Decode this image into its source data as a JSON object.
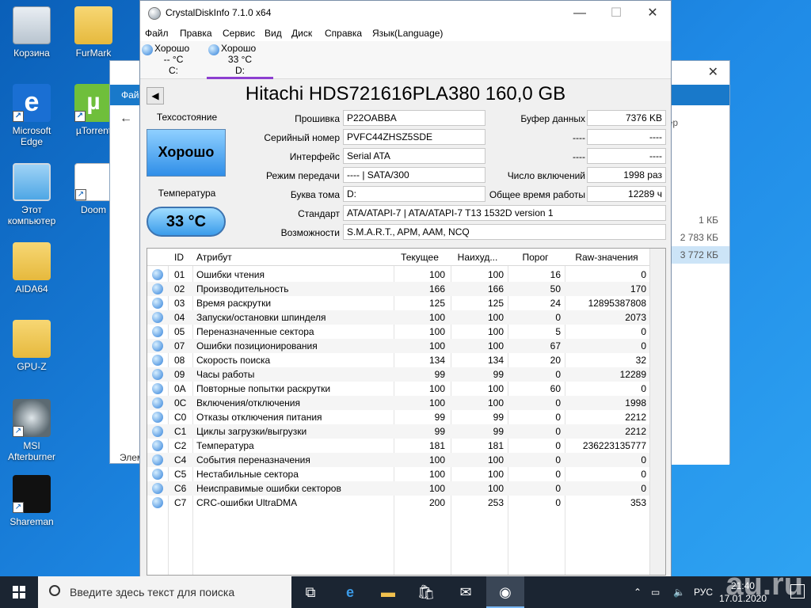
{
  "desktop": {
    "icons": [
      "Корзина",
      "FurMark",
      "Microsoft Edge",
      "µTorrent",
      "Этот компьютер",
      "Doom",
      "AIDA64",
      "GPU-Z",
      "MSI Afterburner",
      "Shareman"
    ]
  },
  "explorer": {
    "ribbon_tab": "Фай",
    "size_col": "змер",
    "sizes": [
      "1 КБ",
      "2 783 КБ",
      "3 772 КБ"
    ],
    "status": "Элем"
  },
  "window": {
    "title": "CrystalDiskInfo 7.1.0 x64",
    "menu": [
      "Файл",
      "Правка",
      "Сервис",
      "Вид",
      "Диск",
      "Справка",
      "Язык(Language)"
    ]
  },
  "drives": [
    {
      "status": "Хорошо",
      "temp": "-- °C",
      "letter": "C:"
    },
    {
      "status": "Хорошо",
      "temp": "33 °C",
      "letter": "D:"
    }
  ],
  "disk": {
    "model": "Hitachi HDS721616PLA380 160,0 GB",
    "health_label": "Техсостояние",
    "health": "Хорошо",
    "temp_label": "Температура",
    "temp": "33 °C",
    "firmware_label": "Прошивка",
    "firmware": "P22OABBA",
    "serial_label": "Серийный номер",
    "serial": "PVFC44ZHSZ5SDE",
    "interface_label": "Интерфейс",
    "interface": "Serial ATA",
    "transfer_label": "Режим передачи",
    "transfer": "---- | SATA/300",
    "letter_label": "Буква тома",
    "letter": "D:",
    "standard_label": "Стандарт",
    "standard": "ATA/ATAPI-7 | ATA/ATAPI-7 T13 1532D version 1",
    "features_label": "Возможности",
    "features": "S.M.A.R.T., APM, AAM, NCQ",
    "buffer_label": "Буфер данных",
    "buffer": "7376 KB",
    "blank1_label": "----",
    "blank1": "----",
    "blank2_label": "----",
    "blank2": "----",
    "power_count_label": "Число включений",
    "power_count": "1998 раз",
    "power_hours_label": "Общее время работы",
    "power_hours": "12289 ч"
  },
  "smart": {
    "headers": {
      "id": "ID",
      "name": "Атрибут",
      "cur": "Текущее",
      "worst": "Наихуд...",
      "thr": "Порог",
      "raw": "Raw-значения"
    },
    "rows": [
      {
        "id": "01",
        "name": "Ошибки чтения",
        "cur": "100",
        "worst": "100",
        "thr": "16",
        "raw": "0"
      },
      {
        "id": "02",
        "name": "Производительность",
        "cur": "166",
        "worst": "166",
        "thr": "50",
        "raw": "170"
      },
      {
        "id": "03",
        "name": "Время раскрутки",
        "cur": "125",
        "worst": "125",
        "thr": "24",
        "raw": "12895387808"
      },
      {
        "id": "04",
        "name": "Запуски/остановки шпинделя",
        "cur": "100",
        "worst": "100",
        "thr": "0",
        "raw": "2073"
      },
      {
        "id": "05",
        "name": "Переназначенные сектора",
        "cur": "100",
        "worst": "100",
        "thr": "5",
        "raw": "0"
      },
      {
        "id": "07",
        "name": "Ошибки позиционирования",
        "cur": "100",
        "worst": "100",
        "thr": "67",
        "raw": "0"
      },
      {
        "id": "08",
        "name": "Скорость поиска",
        "cur": "134",
        "worst": "134",
        "thr": "20",
        "raw": "32"
      },
      {
        "id": "09",
        "name": "Часы работы",
        "cur": "99",
        "worst": "99",
        "thr": "0",
        "raw": "12289"
      },
      {
        "id": "0A",
        "name": "Повторные попытки раскрутки",
        "cur": "100",
        "worst": "100",
        "thr": "60",
        "raw": "0"
      },
      {
        "id": "0C",
        "name": "Включения/отключения",
        "cur": "100",
        "worst": "100",
        "thr": "0",
        "raw": "1998"
      },
      {
        "id": "C0",
        "name": "Отказы отключения питания",
        "cur": "99",
        "worst": "99",
        "thr": "0",
        "raw": "2212"
      },
      {
        "id": "C1",
        "name": "Циклы загрузки/выгрузки",
        "cur": "99",
        "worst": "99",
        "thr": "0",
        "raw": "2212"
      },
      {
        "id": "C2",
        "name": "Температура",
        "cur": "181",
        "worst": "181",
        "thr": "0",
        "raw": "236223135777"
      },
      {
        "id": "C4",
        "name": "События переназначения",
        "cur": "100",
        "worst": "100",
        "thr": "0",
        "raw": "0"
      },
      {
        "id": "C5",
        "name": "Нестабильные сектора",
        "cur": "100",
        "worst": "100",
        "thr": "0",
        "raw": "0"
      },
      {
        "id": "C6",
        "name": "Неисправимые ошибки секторов",
        "cur": "100",
        "worst": "100",
        "thr": "0",
        "raw": "0"
      },
      {
        "id": "C7",
        "name": "CRC-ошибки UltraDMA",
        "cur": "200",
        "worst": "253",
        "thr": "0",
        "raw": "353"
      }
    ]
  },
  "taskbar": {
    "search_placeholder": "Введите здесь текст для поиска",
    "lang": "РУС",
    "time": "21:40",
    "date": "17.01.2020"
  },
  "watermark": "au.ru"
}
